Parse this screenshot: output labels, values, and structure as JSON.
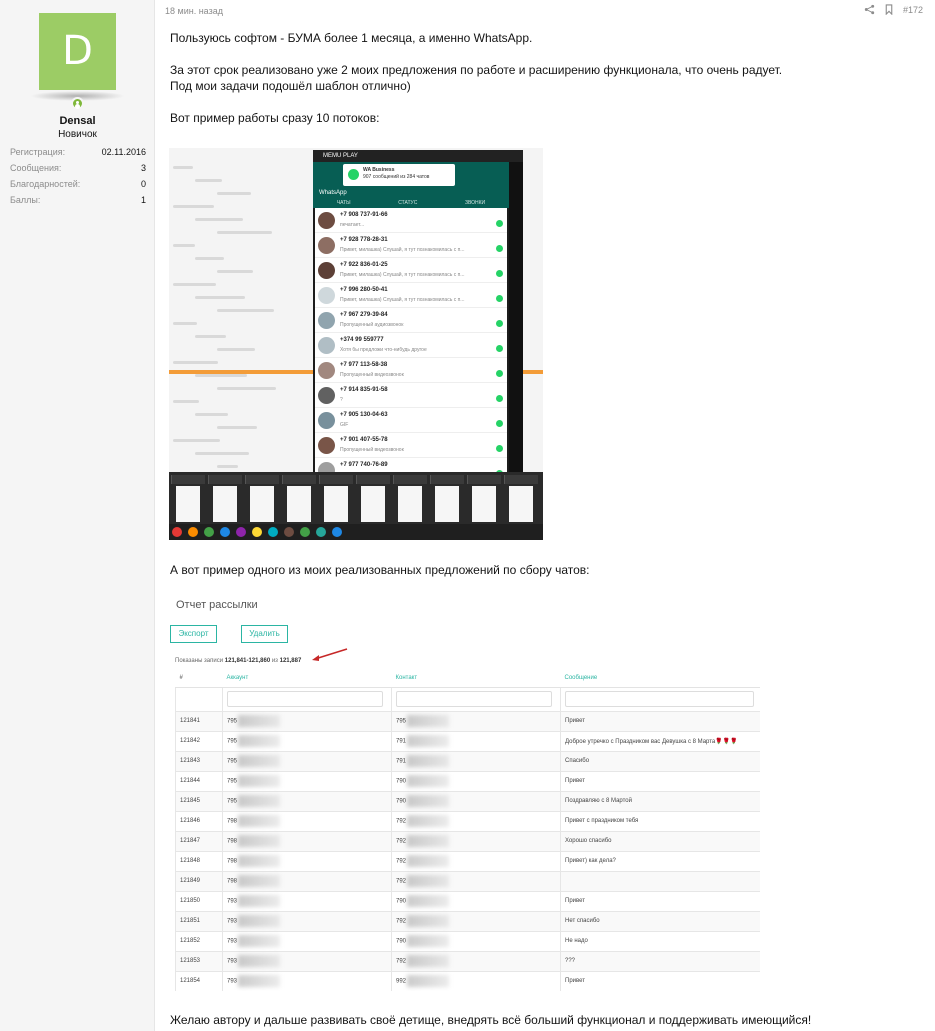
{
  "user": {
    "avatar_letter": "D",
    "avatar_color": "#9ccc65",
    "online_color": "#7fb83a",
    "name": "Densal",
    "title": "Новичок",
    "extras": [
      {
        "label": "Регистрация:",
        "value": "02.11.2016"
      },
      {
        "label": "Сообщения:",
        "value": "3"
      },
      {
        "label": "Благодарностей:",
        "value": "0"
      },
      {
        "label": "Баллы:",
        "value": "1"
      }
    ]
  },
  "post": {
    "time": "18 мин. назад",
    "number": "#172",
    "icons": [
      "share-icon",
      "bookmark-icon"
    ],
    "paragraphs": [
      "Пользуюсь софтом - БУМА более 1 месяца, а именно WhatsApp.",
      "За этот срок реализовано уже 2 моих предложения по работе и расширению функционала, что очень радует.",
      "Под мои задачи подошёл шаблон отлично)",
      "Вот пример работы сразу 10 потоков:",
      "А вот пример одного из моих реализованных предложений по сбору чатов:",
      "Желаю автору и дальше развивать своё детище, внедрять всё больший функционал и поддерживать имеющийся!"
    ]
  },
  "emulator": {
    "app_title": "MEMU PLAY",
    "notification_title": "WA Business",
    "notification_text": "907 сообщений из 284 чатов",
    "header_title": "WhatsApp",
    "tabs": [
      "ЧАТЫ",
      "СТАТУС",
      "ЗВОНКИ"
    ],
    "accent": "#075e54",
    "chats": [
      {
        "name": "+7 908 737-91-66",
        "snippet": "печатает..."
      },
      {
        "name": "+7 928 778-28-31",
        "snippet": "Привет, милашка)   Слушай, я тут познакомилась с п..."
      },
      {
        "name": "+7 922 836-01-25",
        "snippet": "Привет, милашка)   Слушай, я тут познакомилась с п..."
      },
      {
        "name": "+7 996 280-50-41",
        "snippet": "Привет, милашка)   Слушай, я тут познакомилась с п..."
      },
      {
        "name": "+7 967 279-39-84",
        "snippet": "Пропущенный аудиозвонок"
      },
      {
        "name": "+374 99 559777",
        "snippet": "Хотя бы предложи что-нибудь другое"
      },
      {
        "name": "+7 977 113-58-38",
        "snippet": "Пропущенный видеозвонок"
      },
      {
        "name": "+7 914 835-91-58",
        "snippet": "?"
      },
      {
        "name": "+7 905 130-04-63",
        "snippet": "GIF"
      },
      {
        "name": "+7 901 407-55-78",
        "snippet": "Пропущенный видеозвонок"
      },
      {
        "name": "+7 977 740-76-89",
        "snippet": ""
      }
    ]
  },
  "report": {
    "title": "Отчет рассылки",
    "export_label": "Экспорт",
    "delete_label": "Удалить",
    "shown_prefix": "Показаны записи",
    "shown_range": "121,841-121,860",
    "shown_mid": "из",
    "shown_total": "121,887",
    "columns": [
      "#",
      "Аккаунт",
      "Контакт",
      "Сообщение"
    ],
    "accent": "#2bb5a3",
    "rows": [
      {
        "id": "121841",
        "account": "795",
        "contact": "795",
        "message": "Привет"
      },
      {
        "id": "121842",
        "account": "795",
        "contact": "791",
        "message": "Доброе утречко с Праздником вас Девушка с 8 Марта🌹🌹🌹"
      },
      {
        "id": "121843",
        "account": "795",
        "contact": "791",
        "message": "Спасибо"
      },
      {
        "id": "121844",
        "account": "795",
        "contact": "790",
        "message": "Привет"
      },
      {
        "id": "121845",
        "account": "795",
        "contact": "790",
        "message": "Поздравляю с 8 Мартой"
      },
      {
        "id": "121846",
        "account": "798",
        "contact": "792",
        "message": "Привет с праздником тебя"
      },
      {
        "id": "121847",
        "account": "798",
        "contact": "792",
        "message": "Хорошо спасибо"
      },
      {
        "id": "121848",
        "account": "798",
        "contact": "792",
        "message": "Привет) как дела?"
      },
      {
        "id": "121849",
        "account": "798",
        "contact": "792",
        "message": ""
      },
      {
        "id": "121850",
        "account": "793",
        "contact": "790",
        "message": "Привет"
      },
      {
        "id": "121851",
        "account": "793",
        "contact": "792",
        "message": "Нет спасибо"
      },
      {
        "id": "121852",
        "account": "793",
        "contact": "790",
        "message": "Не надо"
      },
      {
        "id": "121853",
        "account": "793",
        "contact": "792",
        "message": "???"
      },
      {
        "id": "121854",
        "account": "793",
        "contact": "992",
        "message": "Привет"
      }
    ]
  }
}
